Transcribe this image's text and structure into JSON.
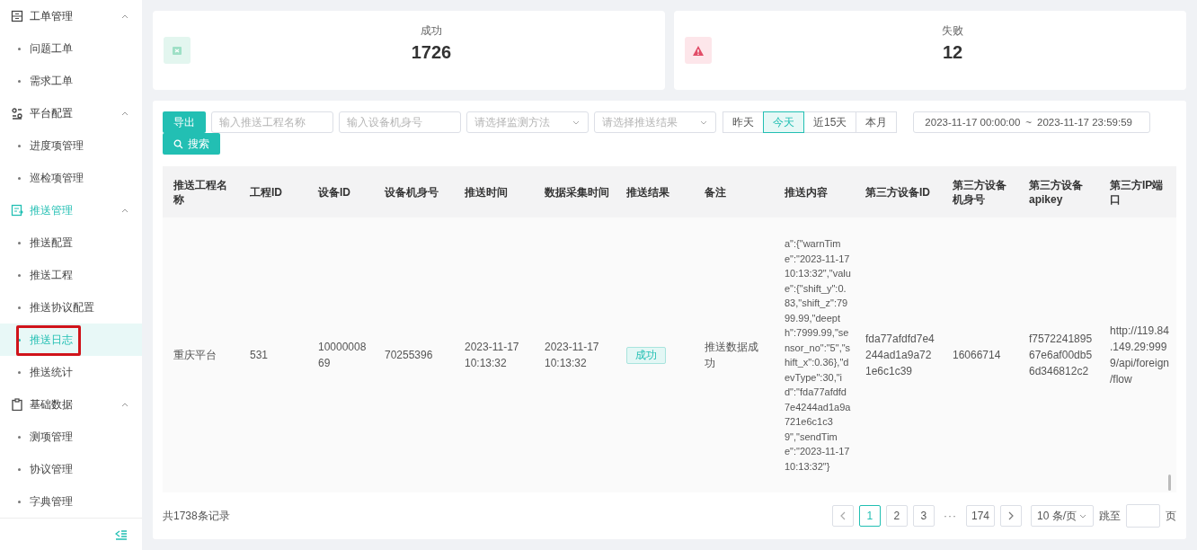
{
  "sidebar": {
    "groups": [
      {
        "label": "工单管理",
        "expanded": true,
        "active": false,
        "items": [
          {
            "label": "问题工单",
            "selected": false,
            "highlighted": false
          },
          {
            "label": "需求工单",
            "selected": false,
            "highlighted": false
          }
        ]
      },
      {
        "label": "平台配置",
        "expanded": true,
        "active": false,
        "items": [
          {
            "label": "进度项管理",
            "selected": false,
            "highlighted": false
          },
          {
            "label": "巡检项管理",
            "selected": false,
            "highlighted": false
          }
        ]
      },
      {
        "label": "推送管理",
        "expanded": true,
        "active": true,
        "items": [
          {
            "label": "推送配置",
            "selected": false,
            "highlighted": false
          },
          {
            "label": "推送工程",
            "selected": false,
            "highlighted": false
          },
          {
            "label": "推送协议配置",
            "selected": false,
            "highlighted": false
          },
          {
            "label": "推送日志",
            "selected": true,
            "highlighted": true
          },
          {
            "label": "推送统计",
            "selected": false,
            "highlighted": false
          }
        ]
      },
      {
        "label": "基础数据",
        "expanded": true,
        "active": false,
        "items": [
          {
            "label": "测项管理",
            "selected": false,
            "highlighted": false
          },
          {
            "label": "协议管理",
            "selected": false,
            "highlighted": false
          },
          {
            "label": "字典管理",
            "selected": false,
            "highlighted": false
          }
        ]
      }
    ]
  },
  "stats": [
    {
      "kind": "success",
      "label": "成功",
      "value": "1726"
    },
    {
      "kind": "failure",
      "label": "失败",
      "value": "12"
    }
  ],
  "filters": {
    "export": "导出",
    "search": "搜索",
    "fields": [
      {
        "kind": "input",
        "placeholder": "输入推送工程名称"
      },
      {
        "kind": "input",
        "placeholder": "输入设备机身号"
      },
      {
        "kind": "select",
        "placeholder": "请选择监测方法"
      },
      {
        "kind": "select",
        "placeholder": "请选择推送结果"
      }
    ],
    "ranges": [
      {
        "label": "昨天",
        "selected": false
      },
      {
        "label": "今天",
        "selected": true
      },
      {
        "label": "近15天",
        "selected": false
      },
      {
        "label": "本月",
        "selected": false
      }
    ],
    "date_range": {
      "start": "2023-11-17 00:00:00",
      "separator": "~",
      "end": "2023-11-17 23:59:59"
    }
  },
  "table": {
    "columns": [
      {
        "label": "推送工程名称",
        "kind": "text"
      },
      {
        "label": "工程ID",
        "kind": "text"
      },
      {
        "label": "设备ID",
        "kind": "text"
      },
      {
        "label": "设备机身号",
        "kind": "text"
      },
      {
        "label": "推送时间",
        "kind": "text"
      },
      {
        "label": "数据采集时间",
        "kind": "text"
      },
      {
        "label": "推送结果",
        "kind": "tag"
      },
      {
        "label": "备注",
        "kind": "text"
      },
      {
        "label": "推送内容",
        "kind": "text"
      },
      {
        "label": "第三方设备ID",
        "kind": "text"
      },
      {
        "label": "第三方设备机身号",
        "kind": "text"
      },
      {
        "label": "第三方设备apikey",
        "kind": "text"
      },
      {
        "label": "第三方IP端口",
        "kind": "text"
      }
    ],
    "rows": [
      {
        "cells": [
          "重庆平台",
          "531",
          "1000000869",
          "70255396",
          "2023-11-17 10:13:32",
          "2023-11-17 10:13:32",
          "成功",
          "推送数据成功",
          "a\":{\"warnTime\":\"2023-11-17 10:13:32\",\"value\":{\"shift_y\":0.83,\"shift_z\":7999.99,\"deepth\":7999.99,\"sensor_no\":\"5\",\"shift_x\":0.36},\"devType\":30,\"id\":\"fda77afdfd7e4244ad1a9a721e6c1c39\",\"sendTime\":\"2023-11-17 10:13:32\"}",
          "fda77afdfd7e4244ad1a9a721e6c1c39",
          "16066714",
          "f757224189567e6af00db56d346812c2",
          "http://119.84.149.29:9999/api/foreign/flow"
        ]
      }
    ]
  },
  "pagination": {
    "total": "共1738条记录",
    "pages": [
      {
        "kind": "page",
        "label": "1",
        "selected": true
      },
      {
        "kind": "page",
        "label": "2",
        "selected": false
      },
      {
        "kind": "page",
        "label": "3",
        "selected": false
      },
      {
        "kind": "ellipsis",
        "label": "···"
      },
      {
        "kind": "page",
        "label": "174",
        "selected": false
      }
    ],
    "page_size": "10 条/页",
    "jump_label": "跳至",
    "page_unit": "页"
  }
}
